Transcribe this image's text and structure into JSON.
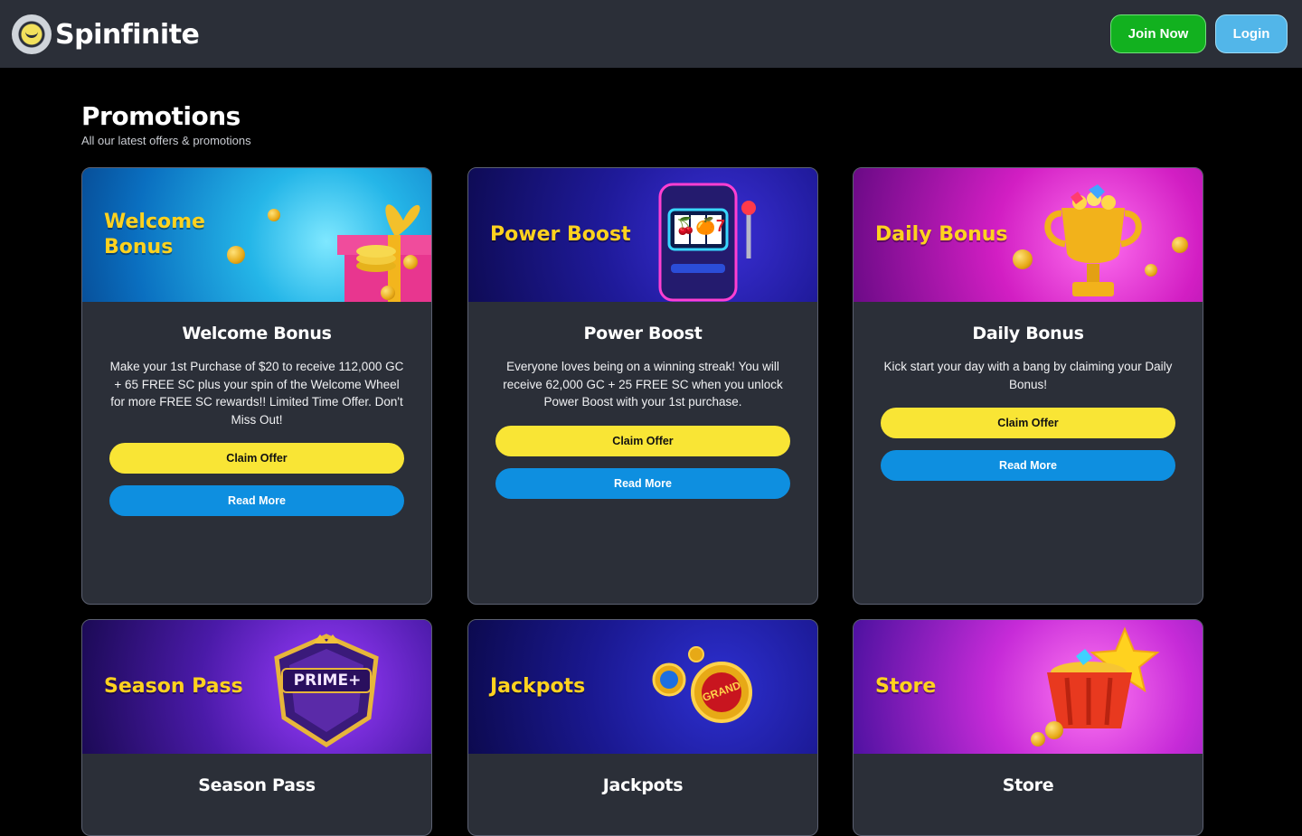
{
  "header": {
    "brand": "Spinfinite",
    "join_label": "Join Now",
    "login_label": "Login"
  },
  "page": {
    "title": "Promotions",
    "subtitle": "All our latest offers & promotions"
  },
  "colors": {
    "header_bg": "#2b2f38",
    "page_bg": "#000000",
    "card_bg": "#2b2f38",
    "join_green": "#12b11f",
    "login_blue": "#52b6e9",
    "claim_yellow": "#f9e535",
    "read_blue": "#0e8fe0",
    "banner_title_yellow": "#ffd21f"
  },
  "promos": [
    {
      "banner_line1": "Welcome",
      "banner_line2": "Bonus",
      "title": "Welcome Bonus",
      "description": "Make your 1st Purchase of $20 to receive 112,000 GC + 65 FREE SC plus your spin of the Welcome Wheel for more FREE SC rewards!! Limited Time Offer. Don't Miss Out!",
      "claim_label": "Claim Offer",
      "read_label": "Read More",
      "art_icon": "gift-box-icon"
    },
    {
      "banner_line1": "Power Boost",
      "title": "Power Boost",
      "description": "Everyone loves being on a winning streak! You will receive 62,000 GC + 25 FREE SC when you unlock Power Boost with your 1st purchase.",
      "claim_label": "Claim Offer",
      "read_label": "Read More",
      "art_icon": "slot-machine-icon",
      "slot_symbols": "🍒🍊7"
    },
    {
      "banner_line1": "Daily Bonus",
      "title": "Daily Bonus",
      "description": "Kick start your day with a bang by claiming your Daily Bonus!",
      "claim_label": "Claim Offer",
      "read_label": "Read More",
      "art_icon": "trophy-icon"
    },
    {
      "banner_line1": "Season Pass",
      "title": "Season Pass",
      "art_icon": "prime-badge-icon",
      "badge_text": "PRIME+"
    },
    {
      "banner_line1": "Jackpots",
      "title": "Jackpots",
      "art_icon": "jackpot-coin-icon",
      "badge_text": "GRAND"
    },
    {
      "banner_line1": "Store",
      "title": "Store",
      "art_icon": "basket-icon"
    }
  ]
}
